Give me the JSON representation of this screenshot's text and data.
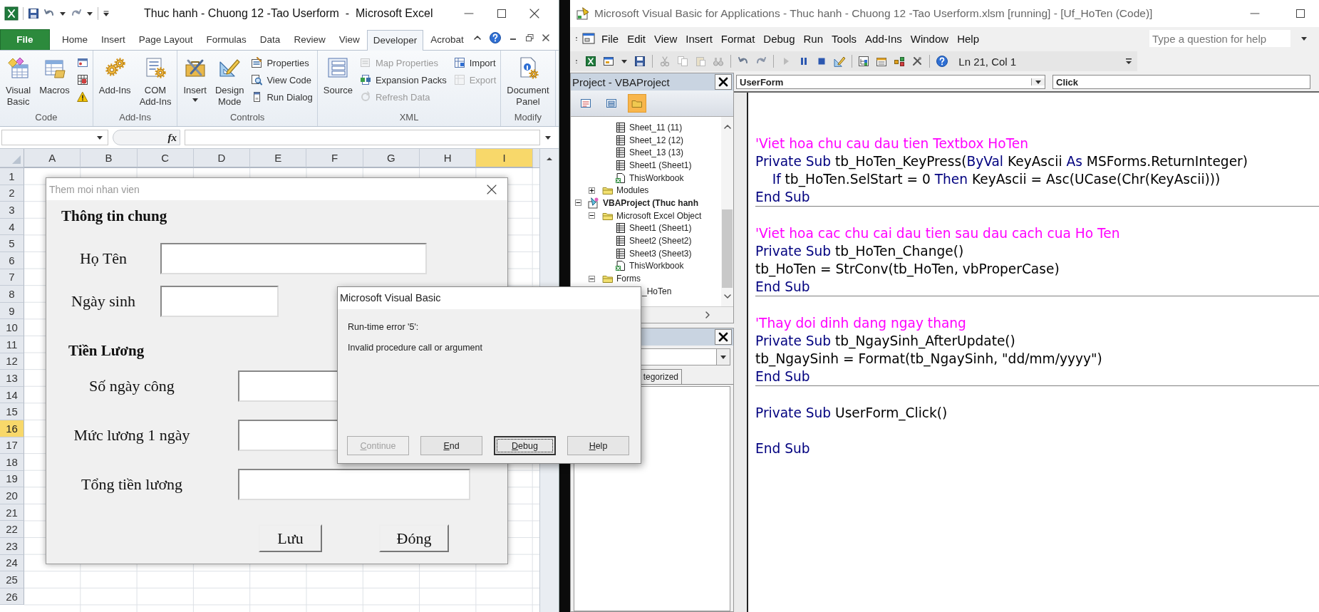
{
  "excel": {
    "title": "Thuc hanh - Chuong 12 -Tao Userform  -  Microsoft Excel",
    "tabs": [
      {
        "label": "File",
        "kind": "file",
        "selected": false
      },
      {
        "label": "Home",
        "kind": "tab",
        "selected": false
      },
      {
        "label": "Insert",
        "kind": "tab",
        "selected": false
      },
      {
        "label": "Page Layout",
        "kind": "tab",
        "selected": false
      },
      {
        "label": "Formulas",
        "kind": "tab",
        "selected": false
      },
      {
        "label": "Data",
        "kind": "tab",
        "selected": false
      },
      {
        "label": "Review",
        "kind": "tab",
        "selected": false
      },
      {
        "label": "View",
        "kind": "tab",
        "selected": false
      },
      {
        "label": "Developer",
        "kind": "tab",
        "selected": true
      },
      {
        "label": "Acrobat",
        "kind": "tab",
        "selected": false
      }
    ],
    "ribbon_groups": [
      {
        "label": "Code",
        "large_buttons": [
          {
            "lines": [
              "Visual",
              "Basic"
            ],
            "dropdown": false
          },
          {
            "lines": [
              "Macros"
            ],
            "dropdown": false
          }
        ],
        "small_buttons": [
          {
            "kind": "icon",
            "disabled": false
          },
          {
            "kind": "icon",
            "disabled": false
          },
          {
            "kind": "icon",
            "disabled": false
          }
        ]
      },
      {
        "label": "Add-Ins",
        "large_buttons": [
          {
            "lines": [
              "Add-Ins"
            ],
            "dropdown": false
          },
          {
            "lines": [
              "COM",
              "Add-Ins"
            ],
            "dropdown": false
          }
        ]
      },
      {
        "label": "Controls",
        "large_buttons": [
          {
            "lines": [
              "Insert"
            ],
            "dropdown": true
          },
          {
            "lines": [
              "Design",
              "Mode"
            ],
            "dropdown": false
          }
        ],
        "small_buttons": [
          {
            "kind": "labeled",
            "label": "Properties",
            "disabled": false
          },
          {
            "kind": "labeled",
            "label": "View Code",
            "disabled": false
          },
          {
            "kind": "labeled",
            "label": "Run Dialog",
            "disabled": false
          }
        ]
      },
      {
        "label": "XML",
        "large_buttons": [
          {
            "lines": [
              "Source"
            ],
            "dropdown": false
          }
        ],
        "small_buttons": [
          {
            "kind": "labeled",
            "label": "Map Properties",
            "disabled": true
          },
          {
            "kind": "labeled",
            "label": "Expansion Packs",
            "disabled": false
          },
          {
            "kind": "labeled",
            "label": "Refresh Data",
            "disabled": true
          },
          {
            "kind": "labeled",
            "label": "Import",
            "disabled": false
          },
          {
            "kind": "labeled",
            "label": "Export",
            "disabled": true
          }
        ]
      },
      {
        "label": "Modify",
        "large_buttons": [
          {
            "lines": [
              "Document",
              "Panel"
            ],
            "dropdown": false
          }
        ]
      }
    ],
    "function_button": "fx",
    "columns": [
      {
        "label": "A",
        "selected": false
      },
      {
        "label": "B",
        "selected": false
      },
      {
        "label": "C",
        "selected": false
      },
      {
        "label": "D",
        "selected": false
      },
      {
        "label": "E",
        "selected": false
      },
      {
        "label": "F",
        "selected": false
      },
      {
        "label": "G",
        "selected": false
      },
      {
        "label": "H",
        "selected": false
      },
      {
        "label": "I",
        "selected": true
      }
    ],
    "rows": [
      {
        "label": "1",
        "selected": false
      },
      {
        "label": "2",
        "selected": false
      },
      {
        "label": "3",
        "selected": false
      },
      {
        "label": "4",
        "selected": false
      },
      {
        "label": "5",
        "selected": false
      },
      {
        "label": "6",
        "selected": false
      },
      {
        "label": "7",
        "selected": false
      },
      {
        "label": "8",
        "selected": false
      },
      {
        "label": "9",
        "selected": false
      },
      {
        "label": "10",
        "selected": false
      },
      {
        "label": "11",
        "selected": false
      },
      {
        "label": "12",
        "selected": false
      },
      {
        "label": "13",
        "selected": false
      },
      {
        "label": "14",
        "selected": false
      },
      {
        "label": "15",
        "selected": false
      },
      {
        "label": "16",
        "selected": true
      },
      {
        "label": "17",
        "selected": false
      },
      {
        "label": "18",
        "selected": false
      },
      {
        "label": "19",
        "selected": false
      },
      {
        "label": "20",
        "selected": false
      },
      {
        "label": "21",
        "selected": false
      },
      {
        "label": "22",
        "selected": false
      },
      {
        "label": "23",
        "selected": false
      },
      {
        "label": "24",
        "selected": false
      },
      {
        "label": "25",
        "selected": false
      },
      {
        "label": "26",
        "selected": false
      }
    ]
  },
  "userform": {
    "title": "Them moi nhan vien",
    "sections": [
      {
        "heading": "Thông tin chung",
        "fields": [
          {
            "label": "Họ Tên"
          },
          {
            "label": "Ngày sinh"
          }
        ]
      },
      {
        "heading": "Tiền Lương",
        "fields": [
          {
            "label": "Số ngày công"
          },
          {
            "label": "Mức lương 1 ngày"
          },
          {
            "label": "Tổng tiền lương"
          }
        ]
      }
    ],
    "buttons": [
      "Lưu",
      "Đóng"
    ]
  },
  "dialog": {
    "title": "Microsoft Visual Basic",
    "message": "Run-time error '5':",
    "detail": "Invalid procedure call or argument",
    "buttons": [
      {
        "label": "Continue",
        "disabled": true,
        "focused": false
      },
      {
        "label": "End",
        "disabled": false,
        "focused": false
      },
      {
        "label": "Debug",
        "disabled": false,
        "focused": true
      },
      {
        "label": "Help",
        "disabled": false,
        "focused": false
      }
    ]
  },
  "vba": {
    "title": "Microsoft Visual Basic for Applications - Thuc hanh - Chuong 12 -Tao Userform.xlsm [running] - [Uf_HoTen (Code)]",
    "menu": [
      "File",
      "Edit",
      "View",
      "Insert",
      "Format",
      "Debug",
      "Run",
      "Tools",
      "Add-Ins",
      "Window",
      "Help"
    ],
    "help_search": {
      "placeholder": "Type a question for help"
    },
    "cursor_position": "Ln 21, Col 1",
    "project_pane": {
      "title": "Project - VBAProject",
      "tree": {
        "continued_items": [
          {
            "label": "Sheet_11 (11)",
            "kind": "sheet"
          },
          {
            "label": "Sheet_12 (12)",
            "kind": "sheet"
          },
          {
            "label": "Sheet_13 (13)",
            "kind": "sheet"
          },
          {
            "label": "Sheet1 (Sheet1)",
            "kind": "sheet"
          },
          {
            "label": "ThisWorkbook",
            "kind": "workbook"
          }
        ],
        "continued_folders": [
          {
            "label": "Modules",
            "expanded": false
          }
        ],
        "projects": [
          {
            "label": "VBAProject (Thuc hanh",
            "expanded": true,
            "children": [
              {
                "label": "Microsoft Excel Object",
                "expanded": true,
                "children": [
                  {
                    "label": "Sheet1 (Sheet1)",
                    "kind": "sheet"
                  },
                  {
                    "label": "Sheet2 (Sheet2)",
                    "kind": "sheet"
                  },
                  {
                    "label": "Sheet3 (Sheet3)",
                    "kind": "sheet"
                  },
                  {
                    "label": "ThisWorkbook",
                    "kind": "workbook"
                  }
                ]
              },
              {
                "label": "Forms",
                "expanded": true,
                "children": [
                  {
                    "label": "_HoTen"
                  }
                ]
              }
            ]
          }
        ]
      }
    },
    "properties_pane": {
      "tab": "tegorized"
    },
    "object_box": "UserForm",
    "procedure_box": "Click",
    "code_blocks": [
      {
        "lines": [
          {
            "segments": [
              {
                "kind": "comment",
                "text": "'Viet hoa chu cau dau tien Textbox HoTen"
              }
            ]
          },
          {
            "segments": [
              {
                "kind": "keyword",
                "text": "Private Sub"
              },
              {
                "kind": "plain",
                "text": " tb_HoTen_KeyPress("
              },
              {
                "kind": "keyword",
                "text": "ByVal"
              },
              {
                "kind": "plain",
                "text": " KeyAscii "
              },
              {
                "kind": "keyword",
                "text": "As"
              },
              {
                "kind": "plain",
                "text": " MSForms.ReturnInteger)"
              }
            ]
          },
          {
            "segments": [
              {
                "kind": "keyword",
                "text": "    If"
              },
              {
                "kind": "plain",
                "text": " tb_HoTen.SelStart = 0 "
              },
              {
                "kind": "keyword",
                "text": "Then"
              },
              {
                "kind": "plain",
                "text": " KeyAscii = Asc(UCase(Chr(KeyAscii)))"
              }
            ]
          },
          {
            "segments": [
              {
                "kind": "keyword",
                "text": "End Sub"
              }
            ]
          }
        ]
      },
      {
        "lines": [
          {
            "segments": [
              {
                "kind": "comment",
                "text": "'Viet hoa cac chu cai dau tien sau dau cach cua Ho Ten"
              }
            ]
          },
          {
            "segments": [
              {
                "kind": "keyword",
                "text": "Private Sub"
              },
              {
                "kind": "plain",
                "text": " tb_HoTen_Change()"
              }
            ]
          },
          {
            "segments": [
              {
                "kind": "plain",
                "text": "tb_HoTen = StrConv(tb_HoTen, vbProperCase)"
              }
            ]
          },
          {
            "segments": [
              {
                "kind": "keyword",
                "text": "End Sub"
              }
            ]
          }
        ]
      },
      {
        "lines": [
          {
            "segments": [
              {
                "kind": "comment",
                "text": "'Thay doi dinh dang ngay thang"
              }
            ]
          },
          {
            "segments": [
              {
                "kind": "keyword",
                "text": "Private Sub"
              },
              {
                "kind": "plain",
                "text": " tb_NgaySinh_AfterUpdate()"
              }
            ]
          },
          {
            "segments": [
              {
                "kind": "plain",
                "text": "tb_NgaySinh = Format(tb_NgaySinh, \"dd/mm/yyyy\")"
              }
            ]
          },
          {
            "segments": [
              {
                "kind": "keyword",
                "text": "End Sub"
              }
            ]
          }
        ]
      },
      {
        "lines": [
          {
            "segments": [
              {
                "kind": "keyword",
                "text": "Private Sub"
              },
              {
                "kind": "plain",
                "text": " UserForm_Click()"
              }
            ]
          },
          {
            "segments": [
              {
                "kind": "keyword",
                "text": "End Sub"
              }
            ]
          }
        ]
      }
    ]
  }
}
